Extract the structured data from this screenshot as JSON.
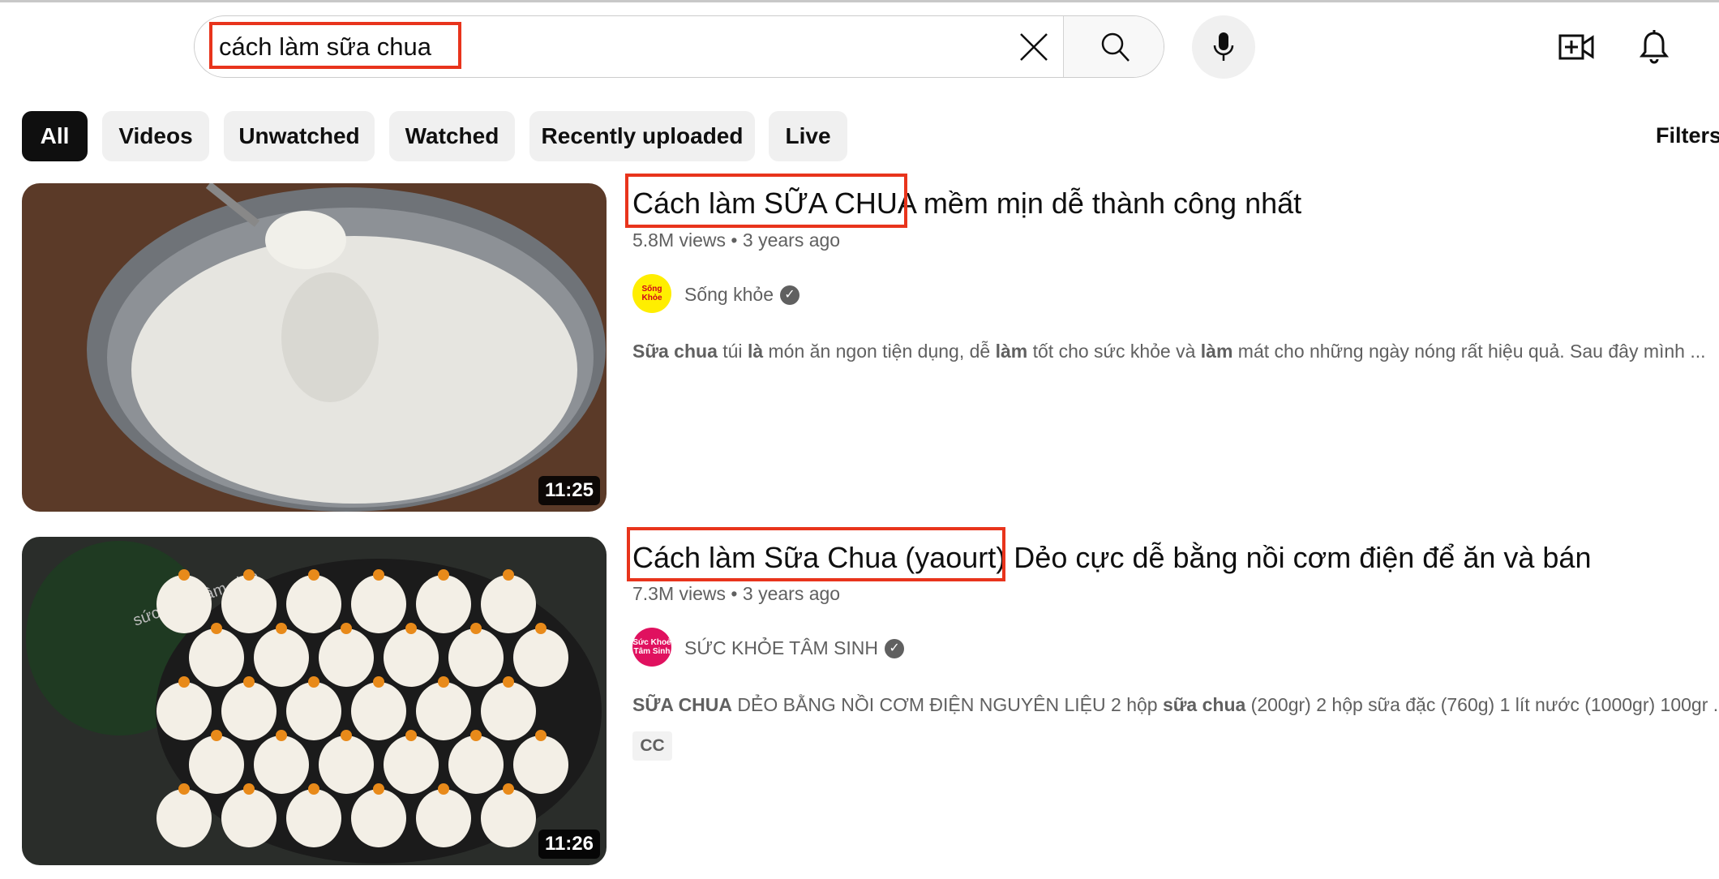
{
  "header": {
    "search_value": "cách làm sữa chua",
    "clear_icon": "close-icon",
    "search_icon": "search-icon",
    "mic_icon": "microphone-icon",
    "create_icon": "video-plus-icon",
    "notifications_icon": "bell-icon"
  },
  "highlight_color": "#e8341c",
  "chips": [
    {
      "label": "All",
      "active": true
    },
    {
      "label": "Videos"
    },
    {
      "label": "Unwatched"
    },
    {
      "label": "Watched"
    },
    {
      "label": "Recently uploaded"
    },
    {
      "label": "Live"
    }
  ],
  "filters_label": "Filters",
  "results": [
    {
      "title_highlight": "Cách làm SỮA CHUA",
      "title_rest": " mềm mịn dễ thành công nhất",
      "views": "5.8M views",
      "age": "3 years ago",
      "channel": "Sống khỏe",
      "avatar_text": "Sống Khỏe",
      "verified": true,
      "duration": "11:25",
      "description": [
        {
          "t": "Sữa chua",
          "b": true
        },
        {
          "t": " túi "
        },
        {
          "t": "là",
          "b": true
        },
        {
          "t": " món ăn ngon tiện dụng, dễ "
        },
        {
          "t": "làm",
          "b": true
        },
        {
          "t": " tốt cho sức khỏe và "
        },
        {
          "t": "làm",
          "b": true
        },
        {
          "t": " mát cho những ngày nóng rất hiệu quả. Sau đây mình ..."
        }
      ]
    },
    {
      "title_highlight": "Cách làm Sữa Chua (yaourt)",
      "title_rest": " Dẻo cực dễ bằng nồi cơm điện để ăn và bán",
      "views": "7.3M views",
      "age": "3 years ago",
      "channel": "SỨC KHỎE TÂM SINH",
      "avatar_text": "Sức Khoẻ Tâm Sinh",
      "verified": true,
      "duration": "11:26",
      "badge": "CC",
      "thumb_watermark": "sức khoẻ tâm sinh",
      "description": [
        {
          "t": "SỮA CHUA",
          "b": true
        },
        {
          "t": " DẺO BẰNG NỒI CƠM ĐIỆN NGUYÊN LIỆU 2 hộp "
        },
        {
          "t": "sữa chua",
          "b": true
        },
        {
          "t": " (200gr) 2 hộp sữa đặc (760g) 1 lít nước (1000gr) 100gr ..."
        }
      ]
    }
  ]
}
